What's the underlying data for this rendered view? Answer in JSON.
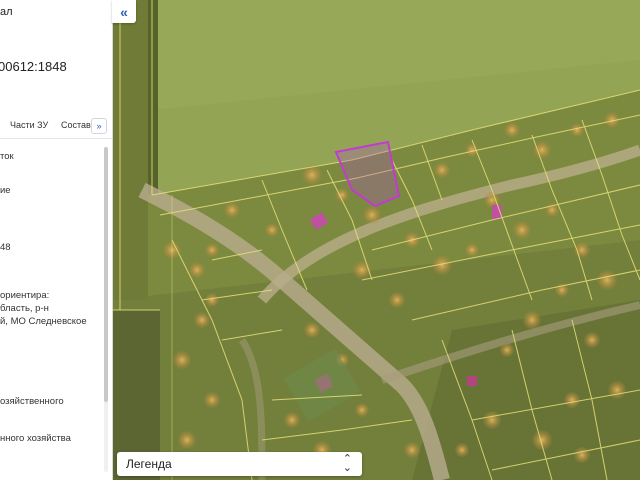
{
  "panel": {
    "title_fragment": "ал",
    "cadastral_fragment": "00612:1848",
    "tabs": [
      "Части ЗУ",
      "Состав"
    ],
    "tab_more": "»",
    "fields": [
      "ток",
      "ие",
      "48",
      "ориентира:",
      "бласть, р-н",
      "й, МО Следневское",
      "озяйственного",
      "нного хозяйства"
    ]
  },
  "map": {
    "collapse_label": "«"
  },
  "legend": {
    "label": "Легенда",
    "chevron": "⌃⌄"
  },
  "colors": {
    "accent": "#2a5fb0",
    "parcel_line": "#e8e07a",
    "selected_parcel": "#c23bd0"
  }
}
